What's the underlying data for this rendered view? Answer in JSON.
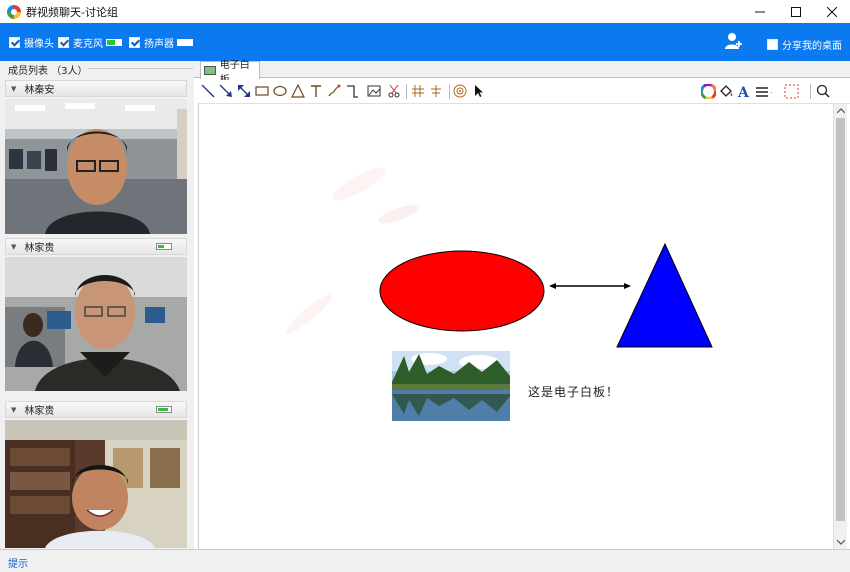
{
  "window": {
    "title": "群视频聊天-讨论组",
    "controls": [
      "minimize",
      "maximize",
      "close"
    ]
  },
  "toolbar": {
    "camera_label": "摄像头",
    "camera_checked": true,
    "mic_label": "麦克风",
    "mic_checked": true,
    "mic_level": 0.6,
    "speaker_label": "扬声器",
    "speaker_checked": true,
    "speaker_level": 0.0,
    "add_member_icon": "person-add-icon",
    "share_desktop_label": "分享我的桌面",
    "share_desktop_checked": false
  },
  "members": {
    "title": "成员列表 （3人）",
    "items": [
      {
        "name": "林秦安",
        "level": null
      },
      {
        "name": "林家贵",
        "level": 0.5
      },
      {
        "name": "林家贵",
        "level": 0.8
      }
    ]
  },
  "whiteboard": {
    "tab_label": "电子白板",
    "tools": [
      "line-icon",
      "arrow-icon",
      "double-arrow-icon",
      "rectangle-icon",
      "ellipse-icon",
      "triangle-icon",
      "text-icon",
      "pen-icon",
      "polyline-icon",
      "image-icon",
      "scissors-icon",
      "grid-icon",
      "align-icon",
      "target-icon",
      "pointer-icon"
    ],
    "right_tools": [
      "color-wheel-icon",
      "fill-bucket-icon",
      "font-icon",
      "line-width-icon",
      "selection-icon",
      "zoom-icon"
    ],
    "text_content": "这是电子白板！",
    "colors": {
      "ellipse": "#ff0000",
      "triangle": "#0000ff",
      "accent": "#0b7af0"
    }
  },
  "status": {
    "label": "提示"
  }
}
